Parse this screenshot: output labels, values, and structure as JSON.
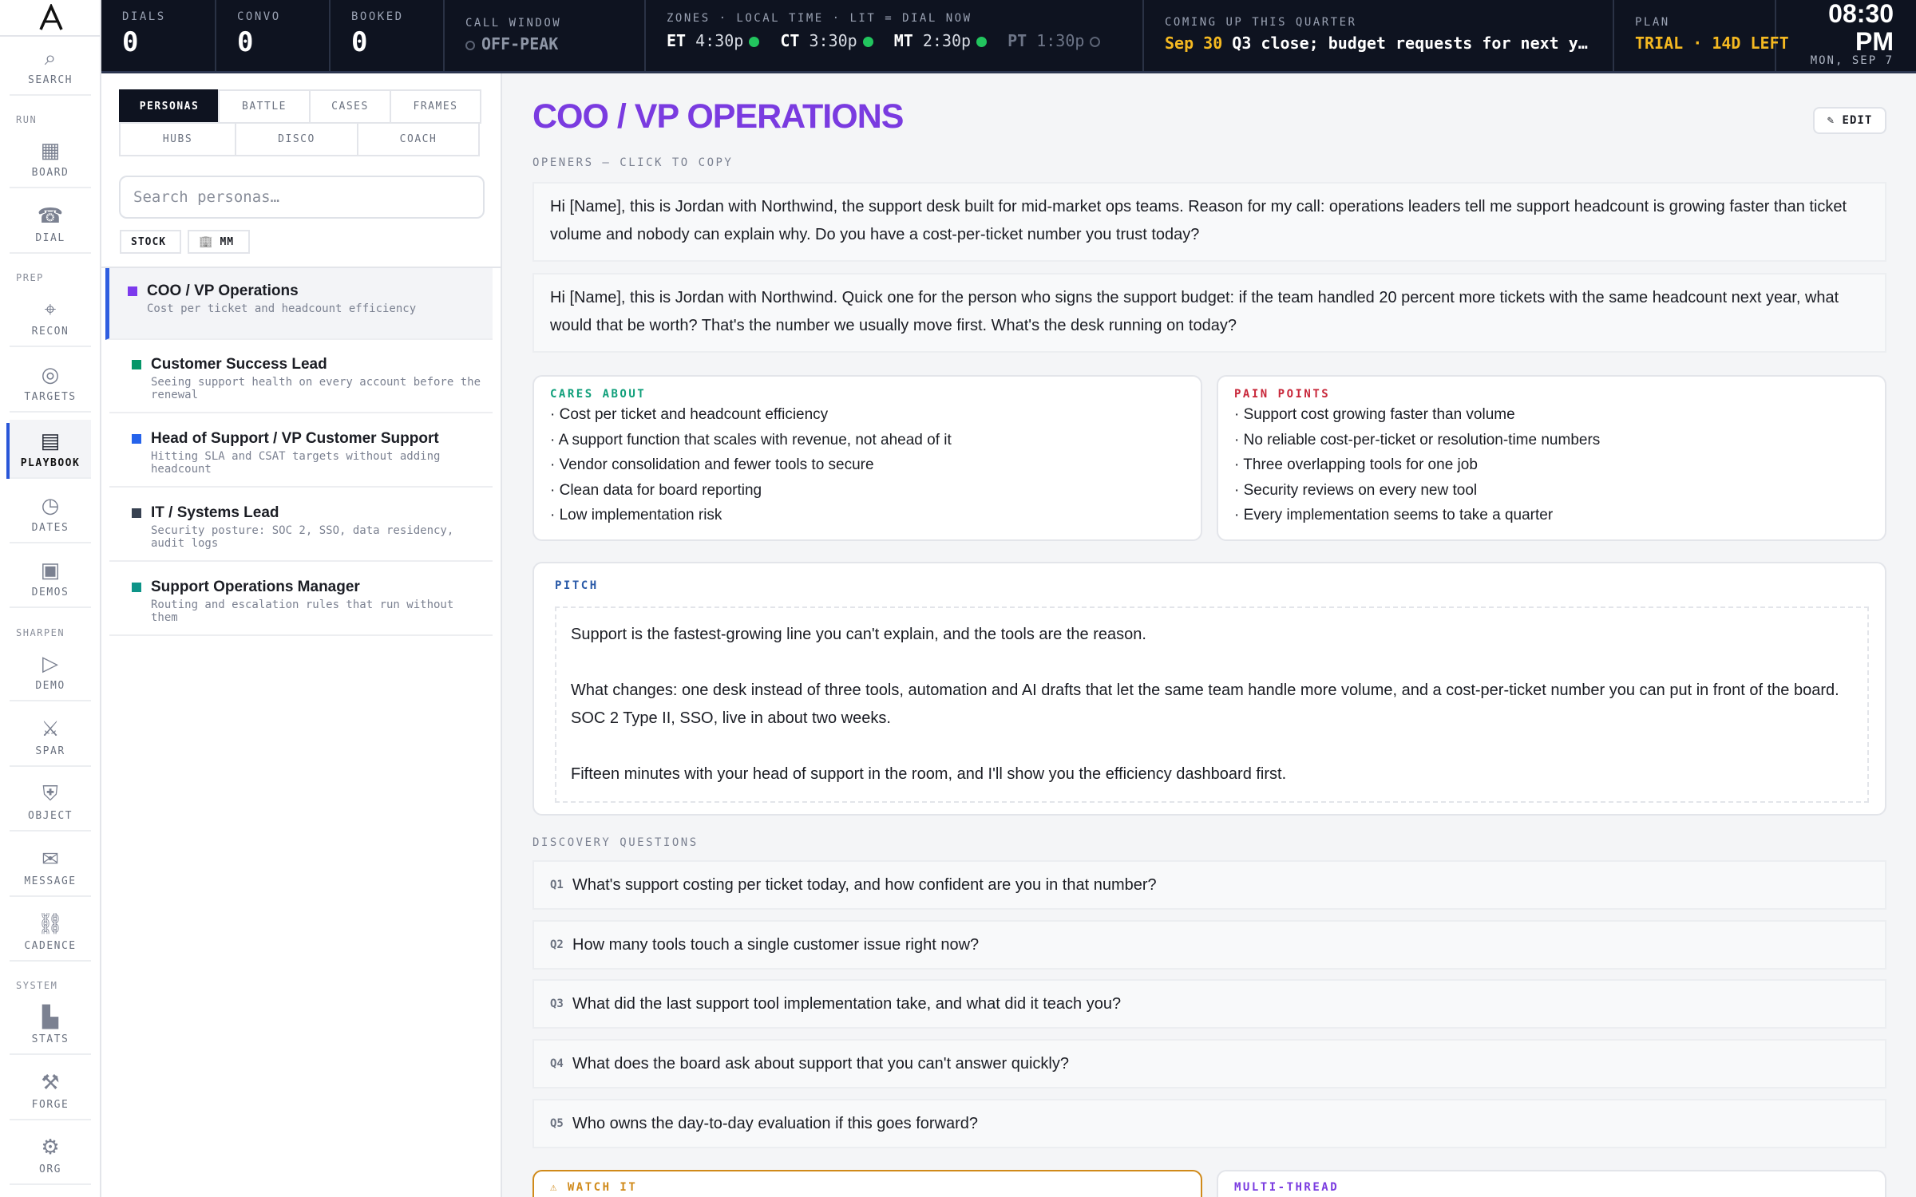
{
  "rail": {
    "logo": "A",
    "sections": {
      "run": "RUN",
      "prep": "PREP",
      "sharpen": "SHARPEN",
      "system": "SYSTEM"
    },
    "items": [
      {
        "label": "SEARCH",
        "icon": "⌕"
      },
      {
        "label": "BOARD",
        "icon": "▦"
      },
      {
        "label": "DIAL",
        "icon": "☎"
      },
      {
        "label": "RECON",
        "icon": "⌖"
      },
      {
        "label": "TARGETS",
        "icon": "◎"
      },
      {
        "label": "PLAYBOOK",
        "icon": "▤"
      },
      {
        "label": "DATES",
        "icon": "◷"
      },
      {
        "label": "DEMOS",
        "icon": "▣"
      },
      {
        "label": "DEMO",
        "icon": "▷"
      },
      {
        "label": "SPAR",
        "icon": "⚔"
      },
      {
        "label": "OBJECT",
        "icon": "⛨"
      },
      {
        "label": "MESSAGE",
        "icon": "✉"
      },
      {
        "label": "CADENCE",
        "icon": "⛓"
      },
      {
        "label": "STATS",
        "icon": "▙"
      },
      {
        "label": "FORGE",
        "icon": "⚒"
      },
      {
        "label": "ORG",
        "icon": "⚙"
      }
    ]
  },
  "topbar": {
    "dials": {
      "label": "DIALS",
      "value": "0"
    },
    "convo": {
      "label": "CONVO",
      "value": "0"
    },
    "booked": {
      "label": "BOOKED",
      "value": "0"
    },
    "call_window": {
      "label": "CALL WINDOW",
      "value": "OFF-PEAK"
    },
    "zones": {
      "label": "ZONES · LOCAL TIME · LIT = DIAL NOW",
      "items": [
        {
          "code": "ET",
          "time": "4:30p",
          "lit": true
        },
        {
          "code": "CT",
          "time": "3:30p",
          "lit": true
        },
        {
          "code": "MT",
          "time": "2:30p",
          "lit": true
        },
        {
          "code": "PT",
          "time": "1:30p",
          "lit": false
        }
      ]
    },
    "upcoming": {
      "label": "COMING UP THIS QUARTER",
      "date": "Sep 30",
      "text": "Q3 close; budget requests for next y…"
    },
    "plan": {
      "label": "PLAN",
      "value": "TRIAL · 14D LEFT"
    },
    "clock": {
      "time": "08:30",
      "ampm": "PM",
      "date": "MON, SEP 7"
    }
  },
  "panel": {
    "tabs_row1": [
      "PERSONAS",
      "BATTLE",
      "CASES",
      "FRAMES"
    ],
    "tabs_row2": [
      "HUBS",
      "DISCO",
      "COACH"
    ],
    "search_placeholder": "Search personas…",
    "chips": {
      "stock": "STOCK",
      "mm": "MM",
      "mm_icon": "🏢"
    },
    "personas": [
      {
        "title": "COO / VP Operations",
        "sub": "Cost per ticket and headcount efficiency",
        "color": "#7c3aed"
      },
      {
        "title": "Customer Success Lead",
        "sub": "Seeing support health on every account before the renewal",
        "color": "#059669"
      },
      {
        "title": "Head of Support / VP Customer Support",
        "sub": "Hitting SLA and CSAT targets without adding headcount",
        "color": "#2563eb"
      },
      {
        "title": "IT / Systems Lead",
        "sub": "Security posture: SOC 2, SSO, data residency, audit logs",
        "color": "#374151"
      },
      {
        "title": "Support Operations Manager",
        "sub": "Routing and escalation rules that run without them",
        "color": "#0d9488"
      }
    ]
  },
  "main": {
    "title": "COO / VP OPERATIONS",
    "edit_label": "✎ EDIT",
    "openers_label": "OPENERS — CLICK TO COPY",
    "openers": [
      "Hi [Name], this is Jordan with Northwind, the support desk built for mid-market ops teams. Reason for my call: operations leaders tell me support headcount is growing faster than ticket volume and nobody can explain why. Do you have a cost-per-ticket number you trust today?",
      "Hi [Name], this is Jordan with Northwind. Quick one for the person who signs the support budget: if the team handled 20 percent more tickets with the same headcount next year, what would that be worth? That's the number we usually move first. What's the desk running on today?"
    ],
    "cares_label": "CARES ABOUT",
    "cares": [
      "Cost per ticket and headcount efficiency",
      "A support function that scales with revenue, not ahead of it",
      "Vendor consolidation and fewer tools to secure",
      "Clean data for board reporting",
      "Low implementation risk"
    ],
    "pains_label": "PAIN POINTS",
    "pains": [
      "Support cost growing faster than volume",
      "No reliable cost-per-ticket or resolution-time numbers",
      "Three overlapping tools for one job",
      "Security reviews on every new tool",
      "Every implementation seems to take a quarter"
    ],
    "pitch_label": "PITCH",
    "pitch": [
      "Support is the fastest-growing line you can't explain, and the tools are the reason.",
      "What changes: one desk instead of three tools, automation and AI drafts that let the same team handle more volume, and a cost-per-ticket number you can put in front of the board. SOC 2 Type II, SSO, live in about two weeks.",
      "Fifteen minutes with your head of support in the room, and I'll show you the efficiency dashboard first."
    ],
    "discovery_label": "DISCOVERY QUESTIONS",
    "questions": [
      {
        "n": "Q1",
        "text": "What's support costing per ticket today, and how confident are you in that number?"
      },
      {
        "n": "Q2",
        "text": "How many tools touch a single customer issue right now?"
      },
      {
        "n": "Q3",
        "text": "What did the last support tool implementation take, and what did it teach you?"
      },
      {
        "n": "Q4",
        "text": "What does the board ask about support that you can't answer quickly?"
      },
      {
        "n": "Q5",
        "text": "Who owns the day-to-day evaluation if this goes forward?"
      }
    ],
    "watch_label": "⚠ WATCH IT",
    "multithread_label": "MULTI-THREAD"
  },
  "colors": {
    "accent_purple": "#7a3be0",
    "cares_green": "#0f9f7a",
    "pain_red": "#c8273a",
    "pitch_blue": "#2a5aa8",
    "warn_amber": "#d08a1a",
    "plan_yellow": "#f5b921"
  }
}
